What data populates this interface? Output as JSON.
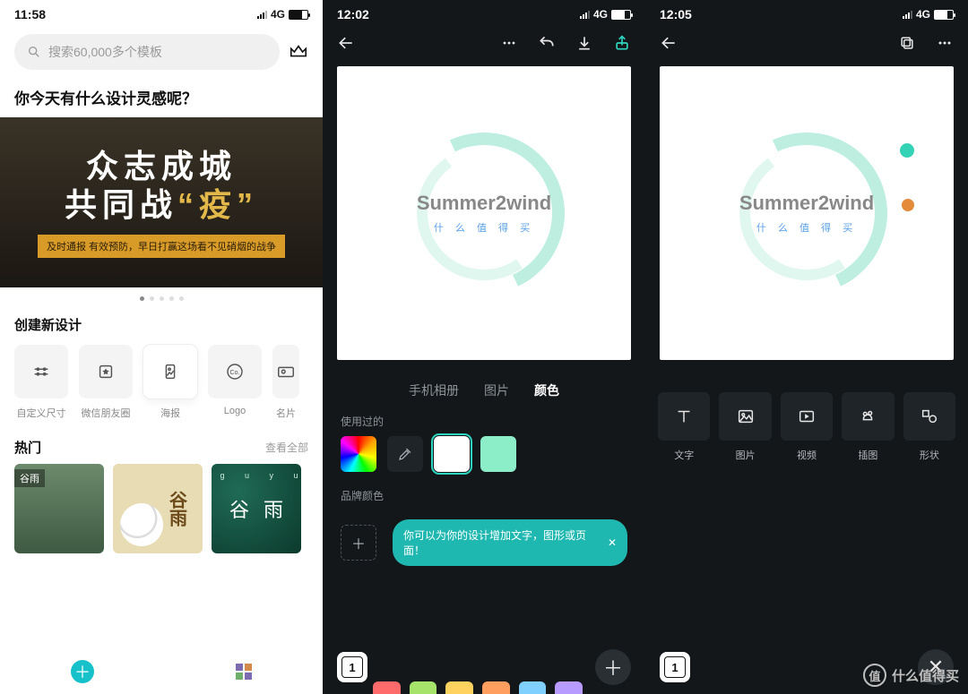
{
  "screen1": {
    "status_time": "11:58",
    "status_net": "4G",
    "search_placeholder": "搜索60,000多个模板",
    "headline": "你今天有什么设计灵感呢？",
    "banner_line1_a": "众志成城",
    "banner_line2_a": "共同战",
    "banner_line2_b": "“疫”",
    "banner_sub": "及时通报 有效预防，早日打赢这场看不见硝烟的战争",
    "create_title": "创建新设计",
    "create_items": [
      "自定义尺寸",
      "微信朋友圈",
      "海报",
      "Logo",
      "名片"
    ],
    "hot_title": "热门",
    "hot_more": "查看全部",
    "thumb1_tag": "谷雨",
    "thumb2_text": "谷雨",
    "thumb3_sub": "g u   y u",
    "thumb3_text": "谷雨"
  },
  "screen2": {
    "status_time": "12:02",
    "status_net": "4G",
    "brand_title": "Summer2wind",
    "brand_sub": "什 么 值 得 买",
    "tabs": [
      "手机相册",
      "图片",
      "颜色"
    ],
    "tabs_active": 2,
    "used_label": "使用过的",
    "brand_label": "品牌颜色",
    "tip_text": "你可以为你的设计增加文字，图形或页面！",
    "page_number": "1",
    "palette": [
      "#ff6b6b",
      "#a6e36a",
      "#ffd25f",
      "#ff9e5f",
      "#7fd0ff",
      "#b79bff"
    ]
  },
  "screen3": {
    "status_time": "12:05",
    "status_net": "4G",
    "brand_title": "Summer2wind",
    "brand_sub": "什 么 值 得 买",
    "tools": [
      "文字",
      "图片",
      "视频",
      "插图",
      "形状"
    ],
    "page_number": "1"
  },
  "watermark": {
    "char": "值",
    "text": "什么值得买"
  }
}
